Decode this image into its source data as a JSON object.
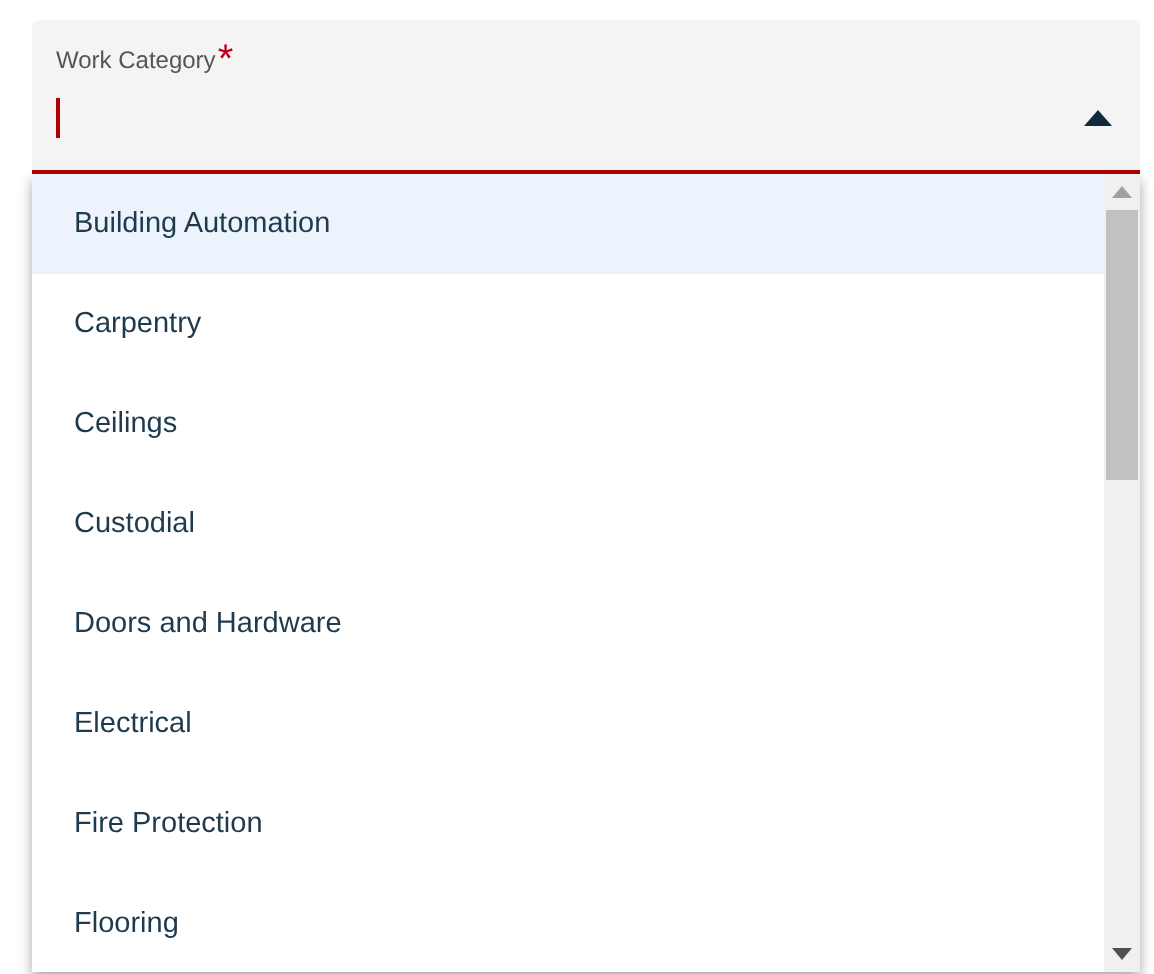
{
  "field": {
    "label": "Work Category",
    "required_mark": "*",
    "focused": true,
    "expanded": true
  },
  "options": [
    {
      "label": "Building Automation",
      "selected": true
    },
    {
      "label": "Carpentry",
      "selected": false
    },
    {
      "label": "Ceilings",
      "selected": false
    },
    {
      "label": "Custodial",
      "selected": false
    },
    {
      "label": "Doors and Hardware",
      "selected": false
    },
    {
      "label": "Electrical",
      "selected": false
    },
    {
      "label": "Fire Protection",
      "selected": false
    },
    {
      "label": "Flooring",
      "selected": false
    }
  ]
}
